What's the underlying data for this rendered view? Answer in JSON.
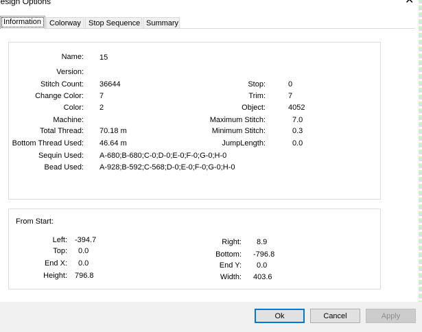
{
  "window": {
    "title": "Design Options",
    "close_glyph": "✕"
  },
  "tabs": [
    {
      "label": "Information",
      "active": true
    },
    {
      "label": "Colorway",
      "active": false
    },
    {
      "label": "Stop Sequence",
      "active": false
    },
    {
      "label": "Summary",
      "active": false
    }
  ],
  "info": {
    "name_label": "Name:",
    "name_value": "15",
    "version_label": "Version:",
    "version_value": "",
    "stitch_count_label": "Stitch Count:",
    "stitch_count_value": "36644",
    "change_color_label": "Change Color:",
    "change_color_value": "7",
    "color_label": "Color:",
    "color_value": "2",
    "machine_label": "Machine:",
    "machine_value": "",
    "total_thread_label": "Total Thread:",
    "total_thread_value": "70.18 m",
    "bottom_thread_label": "Bottom Thread Used:",
    "bottom_thread_value": "46.64 m",
    "sequin_label": "Sequin Used:",
    "sequin_value": "A-680;B-680;C-0;D-0;E-0;F-0;G-0;H-0",
    "bead_label": "Bead Used:",
    "bead_value": "A-928;B-592;C-568;D-0;E-0;F-0;G-0;H-0",
    "stop_label": "Stop:",
    "stop_value": "0",
    "trim_label": "Trim:",
    "trim_value": "7",
    "object_label": "Object:",
    "object_value": "4052",
    "max_stitch_label": "Maximum Stitch:",
    "max_stitch_value": "7.0",
    "min_stitch_label": "Minimum Stitch:",
    "min_stitch_value": "0.3",
    "jump_label": "JumpLength:",
    "jump_value": "0.0"
  },
  "from_start": {
    "heading": "From Start:",
    "left_label": "Left:",
    "left_value": "-394.7",
    "top_label": "Top:",
    "top_value": "0.0",
    "endx_label": "End X:",
    "endx_value": "0.0",
    "height_label": "Height:",
    "height_value": "796.8",
    "right_label": "Right:",
    "right_value": "8.9",
    "bottom_label": "Bottom:",
    "bottom_value": "-796.8",
    "endy_label": "End Y:",
    "endy_value": "0.0",
    "width_label": "Width:",
    "width_value": "403.6"
  },
  "buttons": {
    "ok": "Ok",
    "cancel": "Cancel",
    "apply": "Apply"
  }
}
